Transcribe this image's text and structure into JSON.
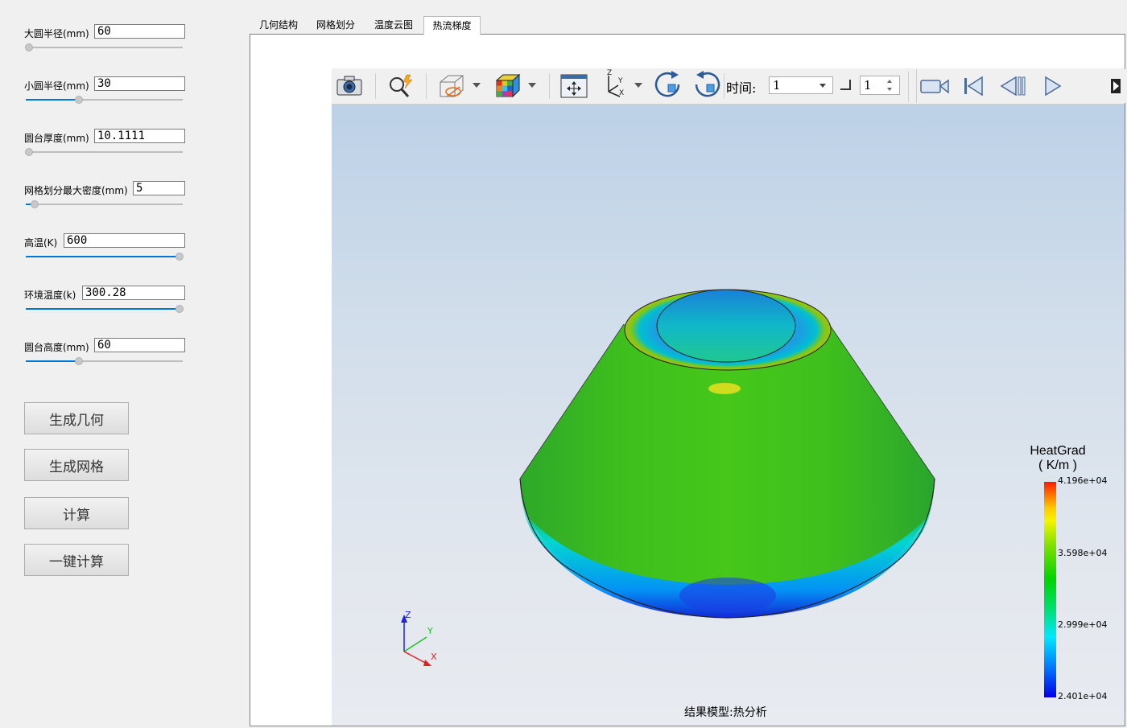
{
  "params": [
    {
      "label": "大圆半径(mm)",
      "value": "60",
      "slider_fraction": 0.0
    },
    {
      "label": "小圆半径(mm)",
      "value": "30",
      "slider_fraction": 0.33
    },
    {
      "label": "圆台厚度(mm)",
      "value": "10.1111",
      "slider_fraction": 0.0
    },
    {
      "label": "网格划分最大密度(mm)",
      "value": "5",
      "slider_fraction": 0.04
    },
    {
      "label": "高温(K)",
      "value": "600",
      "slider_fraction": 1.0
    },
    {
      "label": "环境温度(k)",
      "value": "300.28",
      "slider_fraction": 1.0
    },
    {
      "label": "圆台高度(mm)",
      "value": "60",
      "slider_fraction": 0.33
    }
  ],
  "buttons": {
    "generate_geometry": "生成几何",
    "generate_mesh": "生成网格",
    "compute": "计算",
    "one_click_compute": "一键计算"
  },
  "tabs": [
    {
      "label": "几何结构",
      "active": false
    },
    {
      "label": "网格划分",
      "active": false
    },
    {
      "label": "温度云图",
      "active": false
    },
    {
      "label": "热流梯度",
      "active": true
    }
  ],
  "toolbar": {
    "time_label": "时间:",
    "time_value": "1",
    "spin_value": "1",
    "icons": [
      "camera-icon",
      "zoom-icon",
      "visibility-icon",
      "color-cube-icon",
      "fit-view-icon",
      "axes-icon",
      "rotate-cw-icon",
      "rotate-ccw-icon",
      "record-icon",
      "first-frame-icon",
      "previous-frame-icon",
      "play-icon",
      "more-icon"
    ]
  },
  "legend": {
    "title_line1": "HeatGrad",
    "title_line2": "( K/m )",
    "max": "4.196e+04",
    "v2": "3.598e+04",
    "v3": "2.999e+04",
    "min": "2.401e+04"
  },
  "axes": {
    "z": "Z",
    "y": "Y",
    "x": "X"
  },
  "result_caption": "结果模型:热分析",
  "colors": {
    "accent": "#0078d7",
    "scale_max": "#ff1a00",
    "scale_min": "#0000e8"
  }
}
